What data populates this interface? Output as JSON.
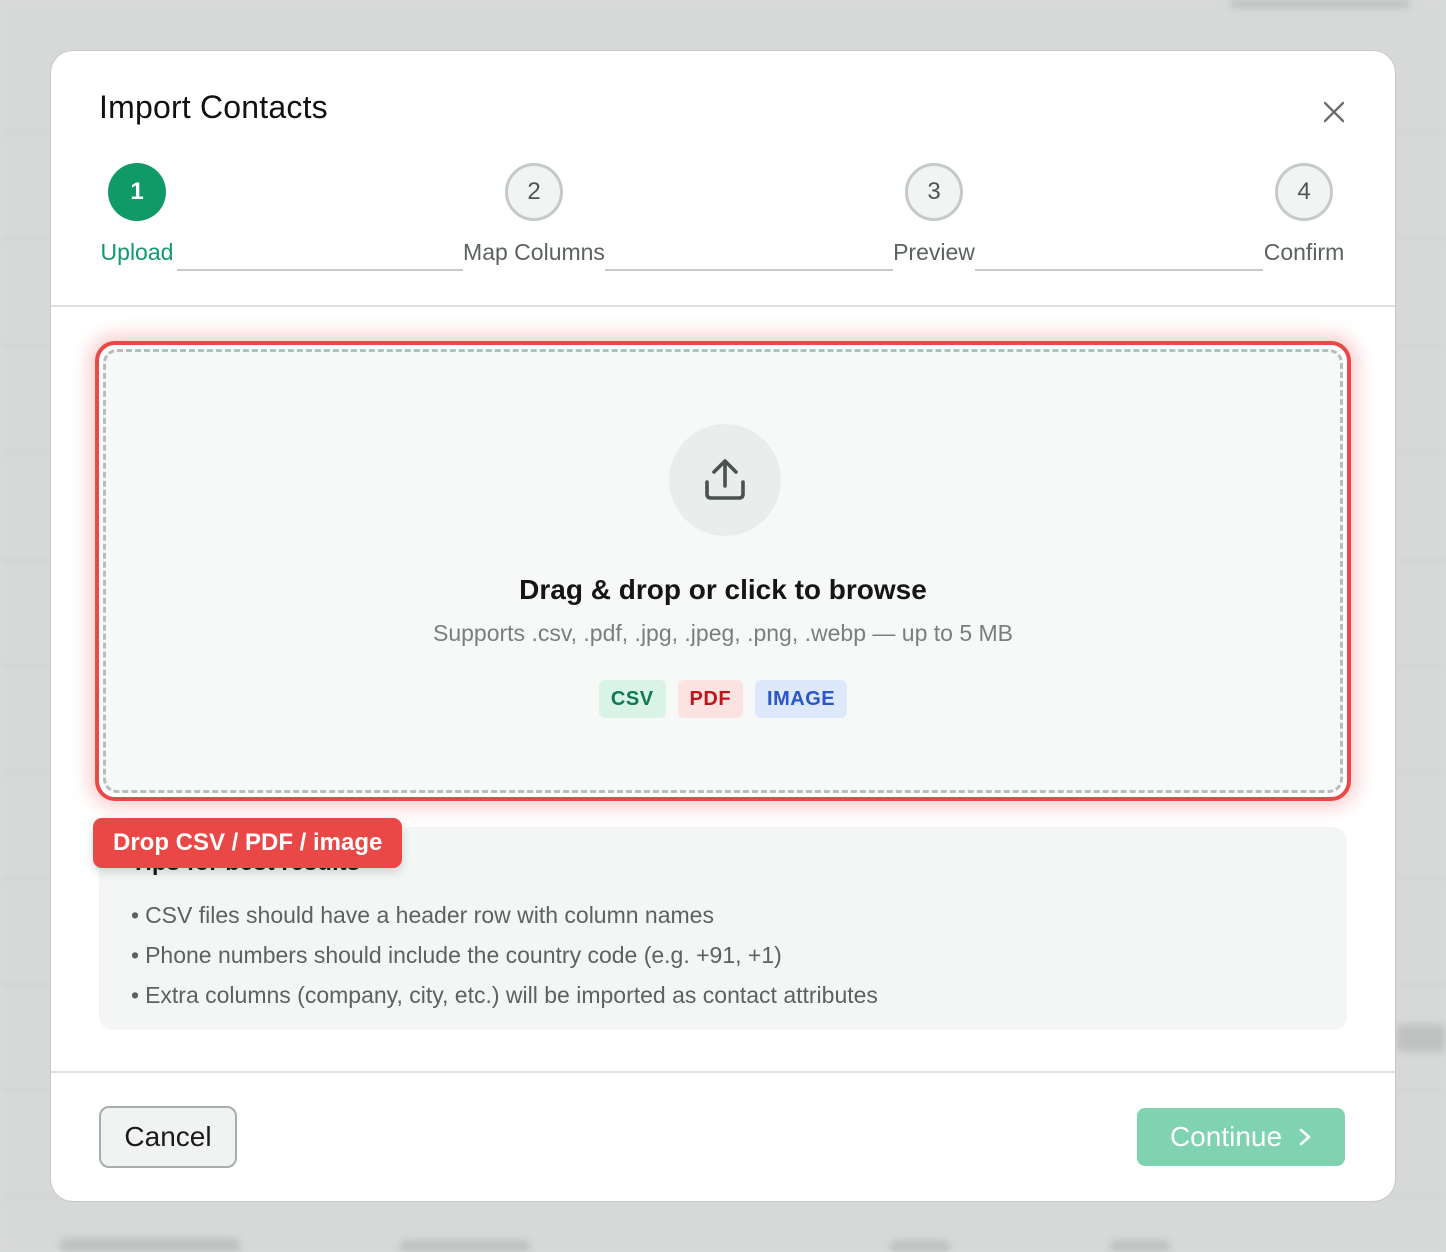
{
  "modal": {
    "title": "Import Contacts"
  },
  "stepper": {
    "steps": [
      {
        "number": "1",
        "label": "Upload",
        "state": "active"
      },
      {
        "number": "2",
        "label": "Map Columns",
        "state": "inactive"
      },
      {
        "number": "3",
        "label": "Preview",
        "state": "inactive"
      },
      {
        "number": "4",
        "label": "Confirm",
        "state": "inactive"
      }
    ]
  },
  "dropzone": {
    "title": "Drag & drop or click to browse",
    "subtitle": "Supports .csv, .pdf, .jpg, .jpeg, .png, .webp — up to 5 MB",
    "icon": "upload-icon",
    "badges": [
      "CSV",
      "PDF",
      "IMAGE"
    ]
  },
  "annotation": {
    "label": "Drop CSV / PDF / image"
  },
  "tips": {
    "heading": "Tips for best results",
    "items": [
      "CSV files should have a header row with column names",
      "Phone numbers should include the country code (e.g. +91, +1)",
      "Extra columns (company, city, etc.) will be imported as contact attributes"
    ]
  },
  "footer": {
    "cancel_label": "Cancel",
    "continue_label": "Continue"
  },
  "colors": {
    "accent": "#0f9a68",
    "highlight": "#ea4747",
    "continue_disabled": "#7fd3b1"
  }
}
